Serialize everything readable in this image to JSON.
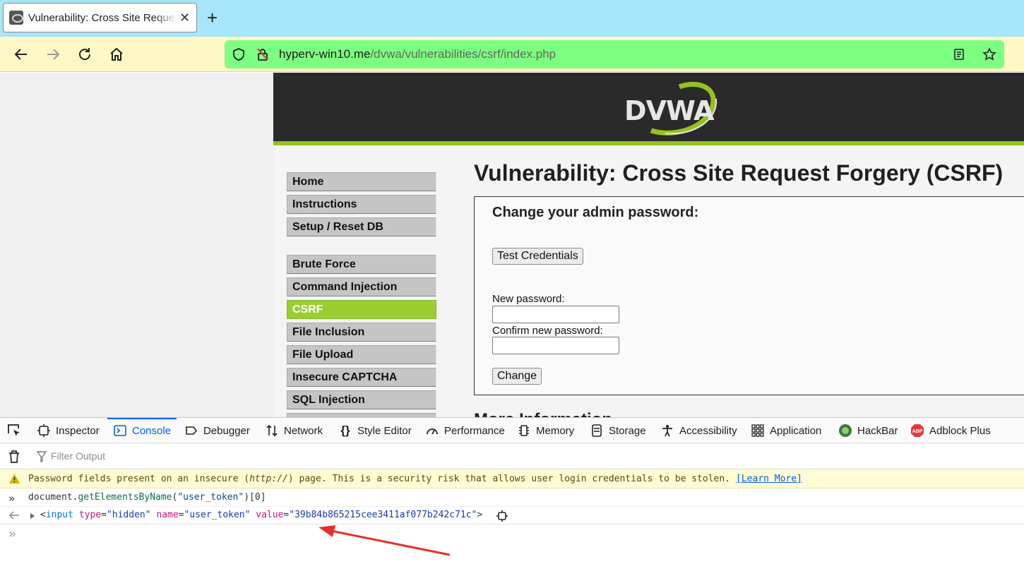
{
  "browser": {
    "tab_title": "Vulnerability: Cross Site Request Forgery (CSRF)",
    "url_host": "hyperv-win10.me",
    "url_path": "/dvwa/vulnerabilities/csrf/index.php"
  },
  "page": {
    "logo_text": "DVWA",
    "title": "Vulnerability: Cross Site Request Forgery (CSRF)",
    "menu_top": [
      "Home",
      "Instructions",
      "Setup / Reset DB"
    ],
    "menu_vulns": [
      "Brute Force",
      "Command Injection",
      "CSRF",
      "File Inclusion",
      "File Upload",
      "Insecure CAPTCHA",
      "SQL Injection"
    ],
    "active_item": "CSRF",
    "form_heading": "Change your admin password:",
    "test_button": "Test Credentials",
    "new_password_label": "New password:",
    "confirm_password_label": "Confirm new password:",
    "change_button": "Change",
    "more_info": "More Information"
  },
  "devtools": {
    "tabs": [
      "Inspector",
      "Console",
      "Debugger",
      "Network",
      "Style Editor",
      "Performance",
      "Memory",
      "Storage",
      "Accessibility",
      "Application",
      "HackBar",
      "Adblock Plus"
    ],
    "selected_tab": "Console",
    "filter_placeholder": "Filter Output",
    "warning_pre": "Password fields present on an insecure (",
    "warning_protocol": "http://",
    "warning_post": ") page. This is a security risk that allows user login credentials to be stolen.",
    "learn_more": "[Learn More]",
    "input_obj": "document",
    "input_fn": "getElementsByName",
    "input_arg": "\"user_token\"",
    "input_idx": "[0]",
    "output_tag": "input",
    "output_attr1": "type",
    "output_val1": "\"hidden\"",
    "output_attr2": "name",
    "output_val2": "\"user_token\"",
    "output_attr3": "value",
    "output_val3": "\"39b84b865215cee3411af077b242c71c\""
  },
  "colors": {
    "accent_green": "#9acd32",
    "url_bar": "#7dff81",
    "annotation_arrow": "#e8302a"
  }
}
